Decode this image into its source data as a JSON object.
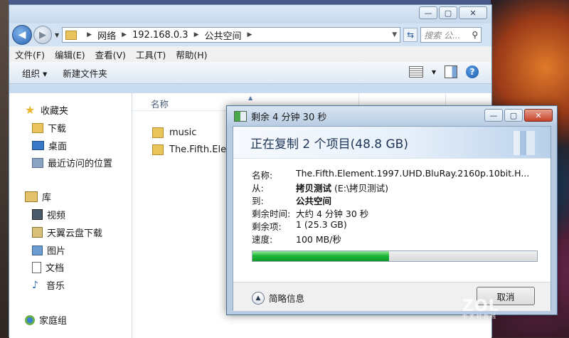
{
  "explorer": {
    "address": {
      "segments": [
        "网络",
        "192.168.0.3",
        "公共空间"
      ],
      "search_placeholder": "搜索 公..."
    },
    "menu": [
      "文件(F)",
      "编辑(E)",
      "查看(V)",
      "工具(T)",
      "帮助(H)"
    ],
    "toolbar": {
      "organize": "组织 ▾",
      "new_folder": "新建文件夹"
    },
    "nav": {
      "favorites": "收藏夹",
      "downloads": "下载",
      "desktop": "桌面",
      "recent": "最近访问的位置",
      "libraries": "库",
      "videos": "视频",
      "tianyi": "天翼云盘下载",
      "pictures": "图片",
      "documents": "文档",
      "music": "音乐",
      "homegroup": "家庭组"
    },
    "content": {
      "column_name": "名称",
      "files": [
        "music",
        "The.Fifth.Element"
      ]
    }
  },
  "dialog": {
    "title": "剩余 4 分钟 30 秒",
    "heading": "正在复制 2 个项目(48.8 GB)",
    "labels": {
      "name": "名称:",
      "from": "从:",
      "to": "到:",
      "time_left": "剩余时间:",
      "items_left": "剩余项:",
      "speed": "速度:"
    },
    "values": {
      "name": "The.Fifth.Element.1997.UHD.BluRay.2160p.10bit.H...",
      "from_bold": "拷贝测试",
      "from_rest": " (E:\\拷贝测试)",
      "to": "公共空间",
      "time_left": "大约 4 分钟 30 秒",
      "items_left": "1 (25.3 GB)",
      "speed": "100 MB/秒"
    },
    "progress_fraction": 0.48,
    "less_info": "简略信息",
    "cancel": "取消"
  },
  "watermark": {
    "logo": "ZOL",
    "sub": "中关村在线"
  }
}
